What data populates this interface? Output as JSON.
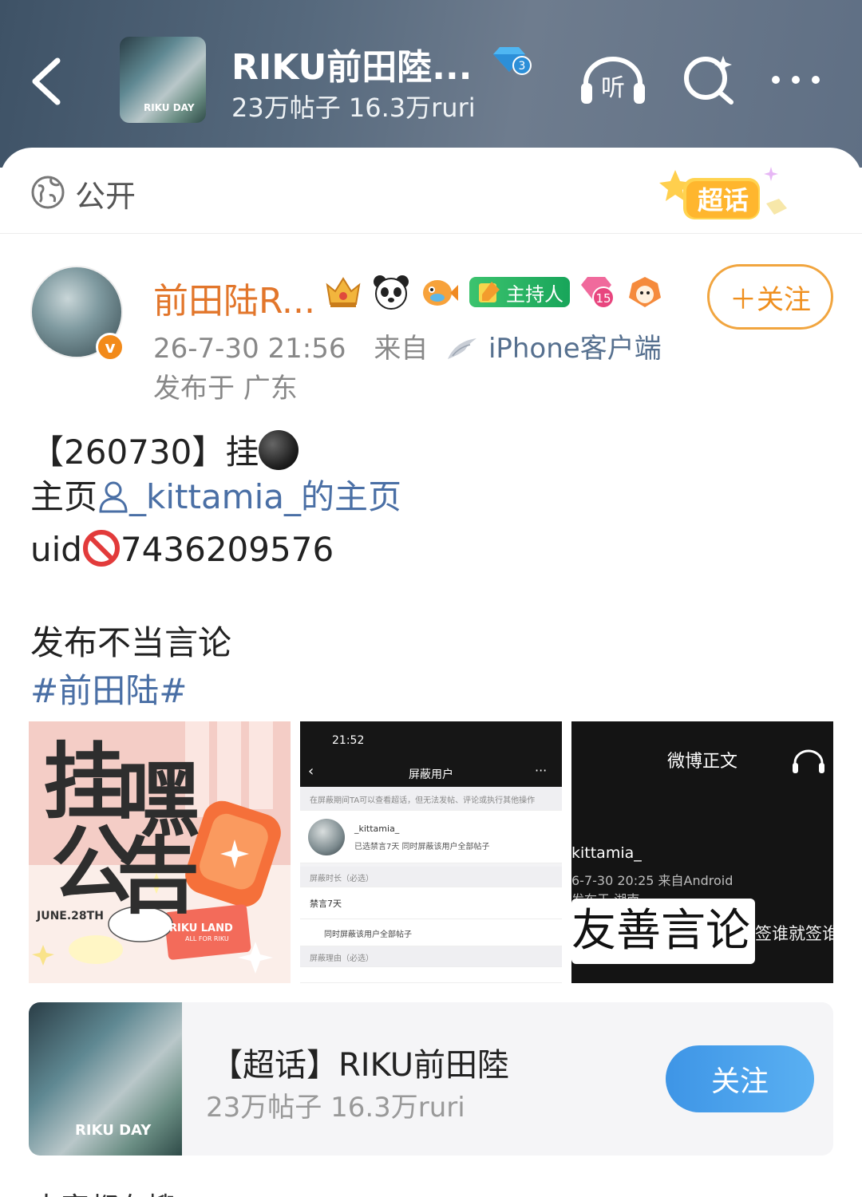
{
  "header": {
    "title": "RIKU前田陸...",
    "subtitle": "23万帖子 16.3万ruri",
    "avatar_tag": "RIKU DAY",
    "level_badge": "3",
    "listen_label": "听"
  },
  "visibility": {
    "label": "公开",
    "supertopic_badge": "超话"
  },
  "author": {
    "name": "前田陆R...",
    "host_badge": "主持人",
    "level": "15",
    "vip_mark": "v",
    "follow_label": "＋关注",
    "meta": {
      "time": "26-7-30 21:56",
      "from": "来自",
      "client": "iPhone客户端",
      "location": "发布于 广东"
    }
  },
  "post": {
    "line1_prefix": "【260730】挂",
    "line2_prefix": "主页",
    "line2_link": "_kittamia_的主页",
    "line3_prefix": "uid",
    "line3_value": "7436209576",
    "line4": "发布不当言论",
    "hashtag": "#前田陆#"
  },
  "images": {
    "img1": {
      "title_a": "挂",
      "title_b": "嘿",
      "title_c": "公",
      "title_d": "告",
      "date": "JUNE.28TH",
      "brand": "RIKU LAND",
      "brand_sub": "ALL FOR RIKU"
    },
    "img2": {
      "time": "21:52",
      "nav_title": "屏蔽用户",
      "note": "在屏蔽期间TA可以查看超话，但无法发帖、评论或执行其他操作",
      "user": "_kittamia_",
      "user_desc": "已选禁言7天 同时屏蔽该用户全部帖子",
      "duration_header": "屏蔽时长（必选）",
      "duration_value": "禁言7天",
      "block_all": "同时屏蔽该用户全部帖子",
      "reason_header": "屏蔽理由（必选）"
    },
    "img3": {
      "title": "微博正文",
      "name": "kittamia_",
      "meta": "6-7-30 20:25  来自Android",
      "meta2": "发布于 湖南",
      "highlight": "友善言论",
      "side": "签谁就签谁"
    }
  },
  "topic_card": {
    "title": "【超话】RIKU前田陸",
    "subtitle": "23万帖子 16.3万ruri",
    "thumb_tag": "RIKU DAY",
    "follow_label": "关注"
  },
  "bottom_hint": "大家都在搜",
  "colors": {
    "accent_orange": "#ef8f1e",
    "link_blue": "#4a6fa5",
    "follow_blue": "#3e95e6",
    "host_green": "#18a55a"
  }
}
